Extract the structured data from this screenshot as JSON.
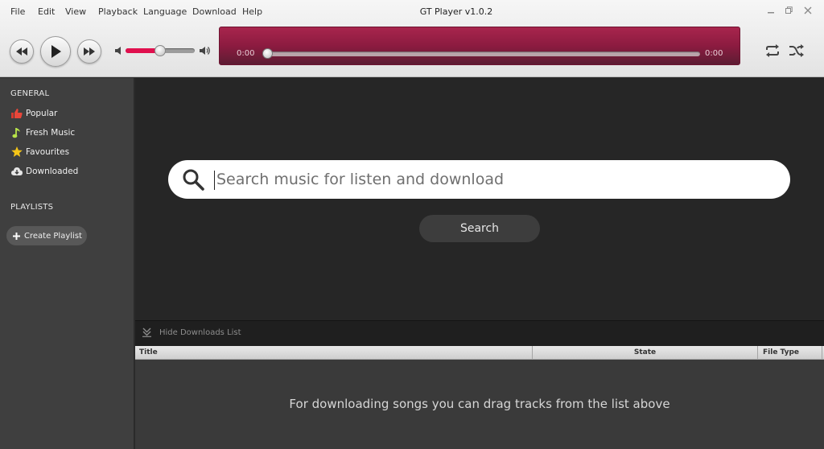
{
  "app": {
    "title": "GT Player v1.0.2"
  },
  "menu": [
    "File",
    "Edit",
    "View",
    "Playback",
    "Language",
    "Download",
    "Help"
  ],
  "player": {
    "time_elapsed": "0:00",
    "time_total": "0:00",
    "volume_level": 0.5,
    "seek_position": 0.0,
    "accent_color": "#e0104e"
  },
  "sidebar": {
    "general_title": "GENERAL",
    "items": [
      {
        "label": "Popular",
        "icon": "thumbs-up-icon"
      },
      {
        "label": "Fresh Music",
        "icon": "music-note-icon"
      },
      {
        "label": "Favourites",
        "icon": "star-icon"
      },
      {
        "label": "Downloaded",
        "icon": "cloud-download-icon"
      }
    ],
    "playlists_title": "PLAYLISTS",
    "create_playlist_label": "Create Playlist"
  },
  "search": {
    "placeholder": "Search music for listen and download",
    "value": "",
    "button_label": "Search"
  },
  "downloads": {
    "toggle_label": "Hide Downloads List",
    "columns": [
      "Title",
      "State",
      "File Type"
    ],
    "empty_message": "For downloading songs you can drag tracks from the list above"
  }
}
